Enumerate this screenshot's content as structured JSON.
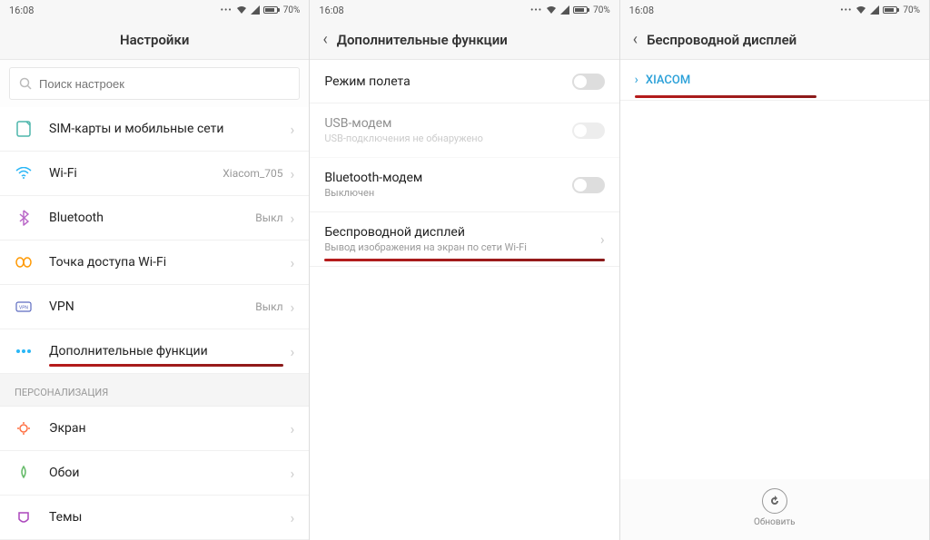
{
  "status": {
    "time": "16:08",
    "battery": "70%"
  },
  "panel1": {
    "title": "Настройки",
    "search_placeholder": "Поиск настроек",
    "items": [
      {
        "label": "SIM-карты и мобильные сети",
        "value": "",
        "icon": "sim"
      },
      {
        "label": "Wi-Fi",
        "value": "Xiacom_705",
        "icon": "wifi"
      },
      {
        "label": "Bluetooth",
        "value": "Выкл",
        "icon": "bluetooth"
      },
      {
        "label": "Точка доступа Wi-Fi",
        "value": "",
        "icon": "hotspot"
      },
      {
        "label": "VPN",
        "value": "Выкл",
        "icon": "vpn"
      },
      {
        "label": "Дополнительные функции",
        "value": "",
        "icon": "more",
        "highlight": true
      }
    ],
    "section_header": "ПЕРСОНАЛИЗАЦИЯ",
    "items2": [
      {
        "label": "Экран",
        "icon": "display"
      },
      {
        "label": "Обои",
        "icon": "wallpaper"
      },
      {
        "label": "Темы",
        "icon": "theme"
      }
    ]
  },
  "panel2": {
    "title": "Дополнительные функции",
    "items": [
      {
        "label": "Режим полета",
        "sublabel": "",
        "type": "toggle"
      },
      {
        "label": "USB-модем",
        "sublabel": "USB-подключения не обнаружено",
        "type": "toggle",
        "disabled": true
      },
      {
        "label": "Bluetooth-модем",
        "sublabel": "Выключен",
        "type": "toggle"
      },
      {
        "label": "Беспроводной дисплей",
        "sublabel": "Вывод изображения на экран по сети Wi-Fi",
        "type": "nav",
        "highlight": true
      }
    ]
  },
  "panel3": {
    "title": "Беспроводной дисплей",
    "device": "XIACOM",
    "refresh_label": "Обновить"
  }
}
